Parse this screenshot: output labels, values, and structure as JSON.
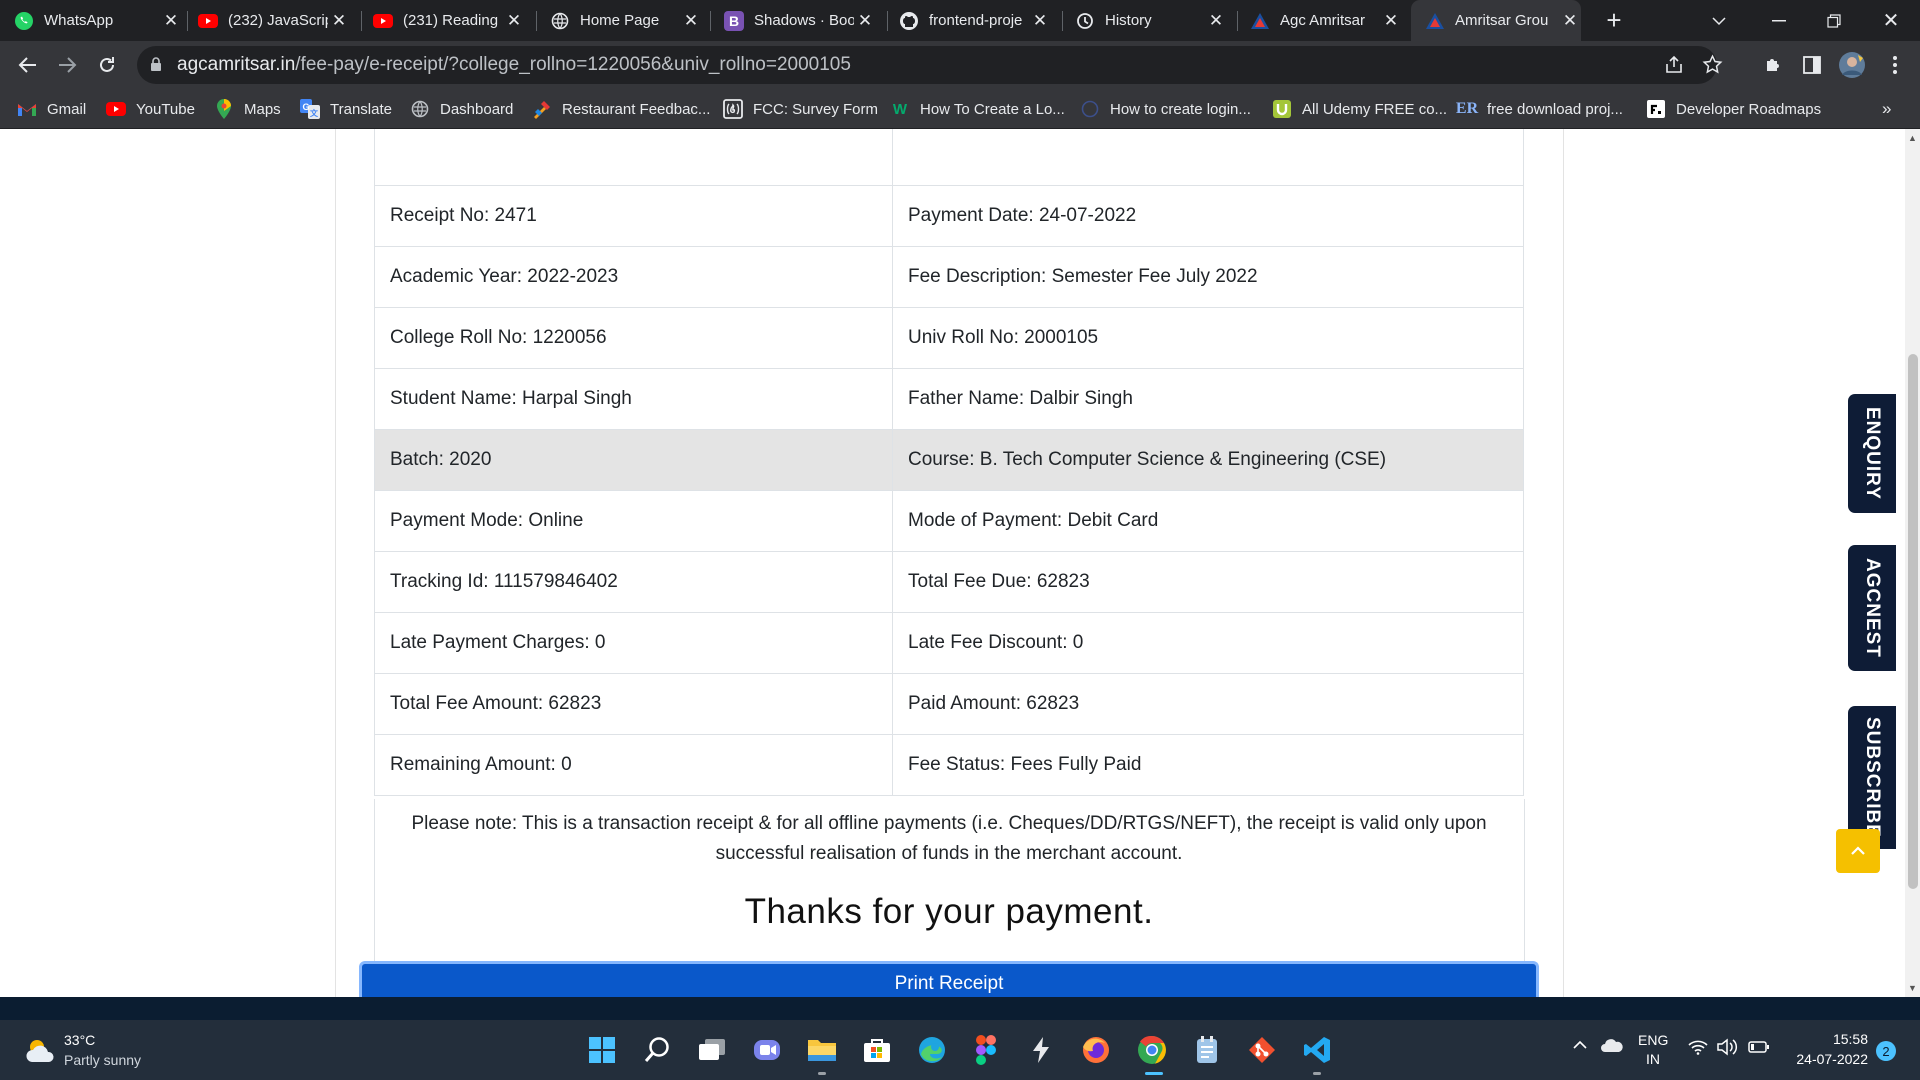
{
  "browser": {
    "tabs": [
      {
        "title": "WhatsApp",
        "icon": "whatsapp-icon",
        "active": false
      },
      {
        "title": "(232) JavaScrip",
        "icon": "youtube-icon",
        "active": false
      },
      {
        "title": "(231) Reading",
        "icon": "youtube-icon",
        "active": false
      },
      {
        "title": "Home Page",
        "icon": "globe-icon",
        "active": false
      },
      {
        "title": "Shadows · Boo",
        "icon": "bootstrap-icon",
        "active": false
      },
      {
        "title": "frontend-proje",
        "icon": "github-icon",
        "active": false
      },
      {
        "title": "History",
        "icon": "history-icon",
        "active": false
      },
      {
        "title": "Agc Amritsar",
        "icon": "agc-icon",
        "active": false
      },
      {
        "title": "Amritsar Grou",
        "icon": "agc-icon",
        "active": true
      }
    ],
    "new_tab_label": "+",
    "url_host": "agcamritsar.in",
    "url_path": "/fee-pay/e-receipt/?college_rollno=1220056&univ_rollno=2000105",
    "bookmarks": [
      {
        "label": "Gmail",
        "icon": "gmail-icon"
      },
      {
        "label": "YouTube",
        "icon": "youtube-icon"
      },
      {
        "label": "Maps",
        "icon": "maps-icon"
      },
      {
        "label": "Translate",
        "icon": "translate-icon"
      },
      {
        "label": "Dashboard",
        "icon": "globe-icon"
      },
      {
        "label": "Restaurant Feedbac...",
        "icon": "restaurant-icon"
      },
      {
        "label": "FCC: Survey Form",
        "icon": "freecodecamp-icon"
      },
      {
        "label": "How To Create a Lo...",
        "icon": "w3-icon"
      },
      {
        "label": "How to create login...",
        "icon": "globe-icon"
      },
      {
        "label": "All Udemy FREE co...",
        "icon": "udemy-icon"
      },
      {
        "label": "free download proj...",
        "icon": "er-icon"
      },
      {
        "label": "Developer Roadmaps",
        "icon": "roadmap-icon"
      }
    ],
    "bookmarks_overflow": "»"
  },
  "receipt": {
    "rows": [
      [
        "",
        ""
      ],
      [
        "Receipt No: 2471",
        "Payment Date: 24-07-2022"
      ],
      [
        "Academic Year: 2022-2023",
        "Fee Description: Semester Fee July 2022"
      ],
      [
        "College Roll No: 1220056",
        "Univ Roll No: 2000105"
      ],
      [
        "Student Name: Harpal Singh",
        "Father Name: Dalbir Singh"
      ],
      [
        "Batch: 2020",
        "Course: B. Tech Computer Science & Engineering (CSE)"
      ],
      [
        "Payment Mode: Online",
        "Mode of Payment: Debit Card"
      ],
      [
        "Tracking Id: 111579846402",
        "Total Fee Due: 62823"
      ],
      [
        "Late Payment Charges: 0",
        "Late Fee Discount: 0"
      ],
      [
        "Total Fee Amount: 62823",
        "Paid Amount: 62823"
      ],
      [
        "Remaining Amount: 0",
        "Fee Status: Fees Fully Paid"
      ]
    ],
    "note_line1": "Please note: This is a transaction receipt & for all offline payments (i.e. Cheques/DD/RTGS/NEFT), the receipt is valid only upon",
    "note_line2": "successful realisation of funds in the merchant account.",
    "thanks": "Thanks for your payment.",
    "print_button": "Print Receipt"
  },
  "side_tabs": [
    "ENQUIRY",
    "AGCNEST",
    "SUBSCRIBE"
  ],
  "taskbar": {
    "weather_temp": "33°C",
    "weather_desc": "Partly sunny",
    "lang_top": "ENG",
    "lang_bottom": "IN",
    "time": "15:58",
    "date": "24-07-2022",
    "notification_count": "2"
  },
  "colors": {
    "print_button": "#0a58ca",
    "side_tab": "#0e1c36",
    "scroll_top": "#f5c000",
    "highlight_row": "#e4e4e4"
  }
}
